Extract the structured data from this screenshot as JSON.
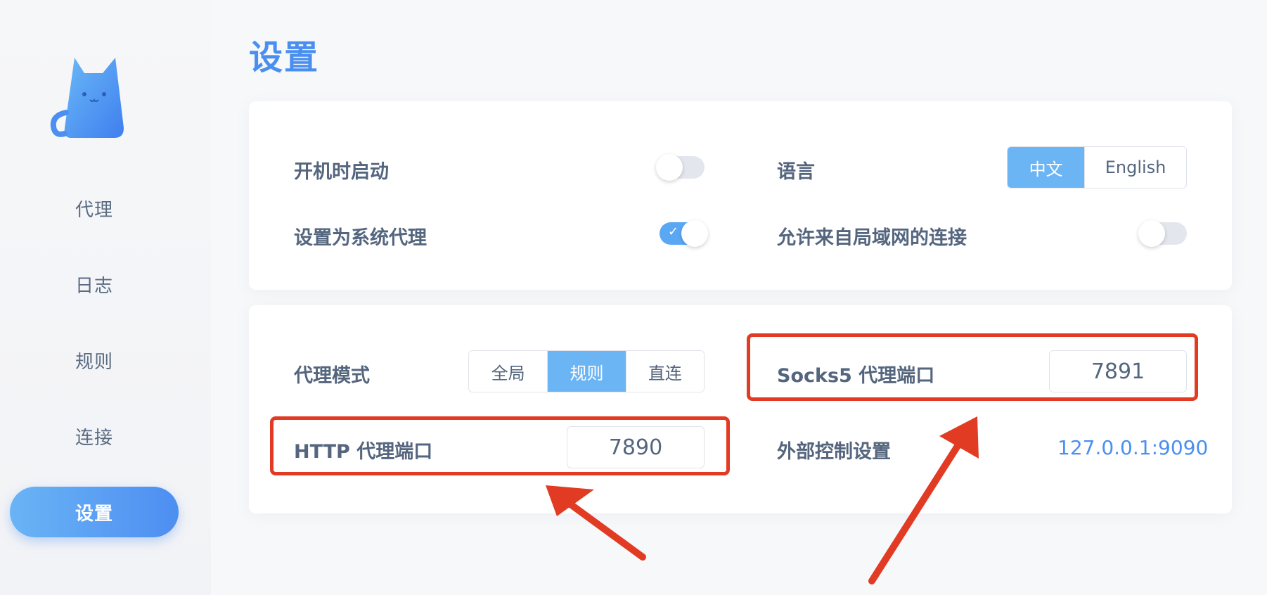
{
  "window": {
    "traffic_lights": [
      "close",
      "minimize",
      "zoom"
    ]
  },
  "sidebar": {
    "items": [
      {
        "label": "代理"
      },
      {
        "label": "日志"
      },
      {
        "label": "规则"
      },
      {
        "label": "连接"
      },
      {
        "label": "设置",
        "active": true
      }
    ]
  },
  "page": {
    "title": "设置"
  },
  "general": {
    "autostart_label": "开机时启动",
    "autostart_enabled": false,
    "system_proxy_label": "设置为系统代理",
    "system_proxy_enabled": true,
    "language_label": "语言",
    "language_options": [
      "中文",
      "English"
    ],
    "language_selected": "中文",
    "allow_lan_label": "允许来自局域网的连接",
    "allow_lan_enabled": false
  },
  "proxy": {
    "mode_label": "代理模式",
    "mode_options": [
      "全局",
      "规则",
      "直连"
    ],
    "mode_selected": "规则",
    "http_port_label": "HTTP 代理端口",
    "http_port": "7890",
    "socks_port_label": "Socks5 代理端口",
    "socks_port": "7891",
    "external_controller_label": "外部控制设置",
    "external_controller": "127.0.0.1:9090"
  },
  "colors": {
    "accent": "#4a8ff0",
    "annotation": "#e23b24"
  }
}
